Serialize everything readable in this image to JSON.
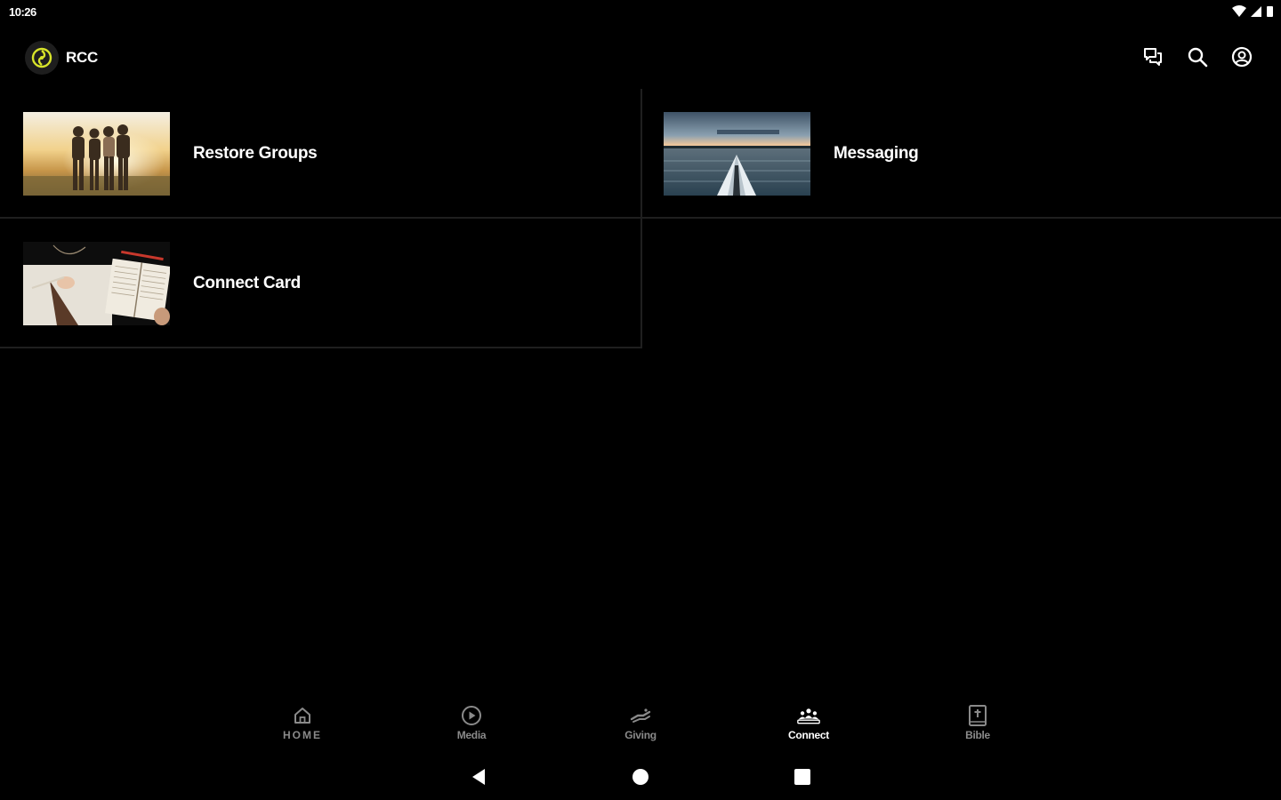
{
  "status_bar": {
    "time": "10:26"
  },
  "app_bar": {
    "title": "RCC",
    "logo_color": "#d7e32a",
    "actions": [
      "chat-icon",
      "search-icon",
      "account-icon"
    ]
  },
  "tiles": [
    {
      "label": "Restore Groups",
      "image": "group-sunset-photo"
    },
    {
      "label": "Messaging",
      "image": "kayak-lake-photo"
    },
    {
      "label": "Connect Card",
      "image": "bible-notebook-photo"
    }
  ],
  "bottom_nav": {
    "items": [
      {
        "label": "HOME",
        "icon": "home-icon"
      },
      {
        "label": "Media",
        "icon": "play-icon"
      },
      {
        "label": "Giving",
        "icon": "giving-hand-icon"
      },
      {
        "label": "Connect",
        "icon": "people-icon"
      },
      {
        "label": "Bible",
        "icon": "bible-icon"
      }
    ],
    "active": "Connect",
    "active_color": "#ffffff",
    "inactive_color": "#8a8a8a"
  }
}
